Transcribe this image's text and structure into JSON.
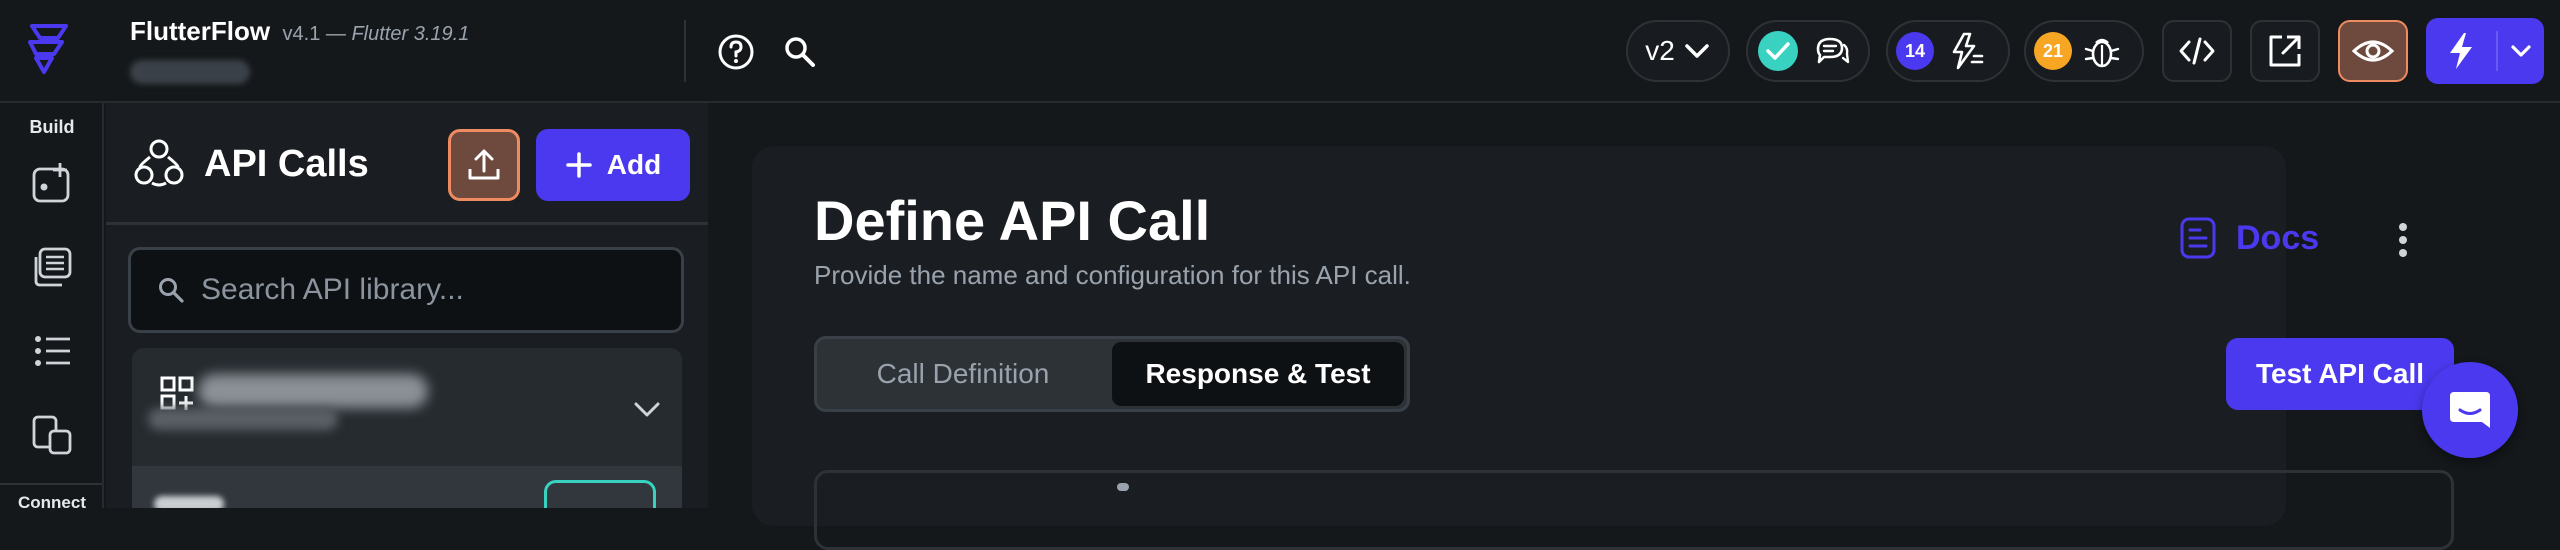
{
  "app": {
    "name": "FlutterFlow",
    "version": "v4.1 —",
    "flutter_version": "Flutter 3.19.1"
  },
  "topbar": {
    "version_select": "v2",
    "issues_count": "14",
    "bugs_count": "21",
    "colors": {
      "accent": "#4b39ef",
      "success": "#39d2c0",
      "warning": "#f6a623",
      "preview_bg": "#6e4a3e",
      "preview_border": "#ee8b60"
    }
  },
  "rail": {
    "build_label": "Build",
    "connect_label": "Connect"
  },
  "panel": {
    "title": "API Calls",
    "add_label": "Add",
    "search_placeholder": "Search API library..."
  },
  "main": {
    "title": "Define API Call",
    "subtitle": "Provide the name and configuration for this API call.",
    "docs_label": "Docs",
    "tabs": [
      {
        "label": "Call Definition",
        "active": false
      },
      {
        "label": "Response & Test",
        "active": true
      }
    ],
    "test_button_label": "Test API Call"
  }
}
